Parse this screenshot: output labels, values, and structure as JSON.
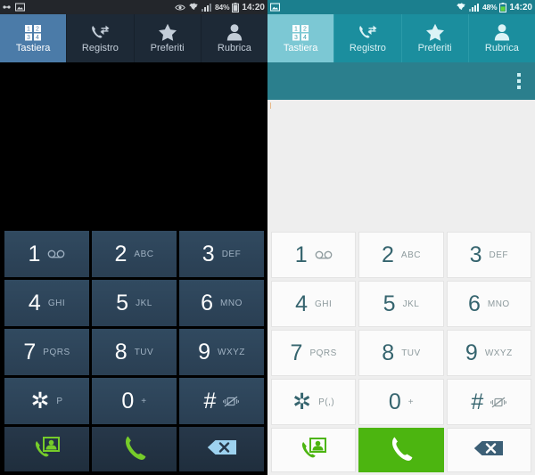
{
  "screens": [
    {
      "id": "dark-dialer",
      "theme": "dark",
      "statusbar": {
        "left_icons": [
          "usb-debug-icon",
          "screenshot-icon"
        ],
        "right_icons": [
          "smart-stay-eye-icon",
          "wifi-icon",
          "signal-icon"
        ],
        "battery_percent": "84%",
        "battery_icon": "battery-icon",
        "time": "14:20"
      },
      "tabs": [
        {
          "label": "Tastiera",
          "icon": "keypad-icon",
          "active": true
        },
        {
          "label": "Registro",
          "icon": "call-log-icon",
          "active": false
        },
        {
          "label": "Preferiti",
          "icon": "star-icon",
          "active": false
        },
        {
          "label": "Rubrica",
          "icon": "contact-icon",
          "active": false
        }
      ],
      "display_value": "",
      "keys": [
        {
          "digit": "1",
          "sub": "",
          "sub_icon": "voicemail-icon"
        },
        {
          "digit": "2",
          "sub": "ABC",
          "sub_icon": ""
        },
        {
          "digit": "3",
          "sub": "DEF",
          "sub_icon": ""
        },
        {
          "digit": "4",
          "sub": "GHI",
          "sub_icon": ""
        },
        {
          "digit": "5",
          "sub": "JKL",
          "sub_icon": ""
        },
        {
          "digit": "6",
          "sub": "MNO",
          "sub_icon": ""
        },
        {
          "digit": "7",
          "sub": "PQRS",
          "sub_icon": ""
        },
        {
          "digit": "8",
          "sub": "TUV",
          "sub_icon": ""
        },
        {
          "digit": "9",
          "sub": "WXYZ",
          "sub_icon": ""
        },
        {
          "digit": "✲",
          "sub": "P",
          "sub_icon": ""
        },
        {
          "digit": "0",
          "sub": "+",
          "sub_icon": ""
        },
        {
          "digit": "#",
          "sub": "",
          "sub_icon": "vibrate-off-icon"
        }
      ],
      "actions": [
        {
          "name": "add-contact-call-button",
          "icon": "add-contact-call-icon",
          "primary": false
        },
        {
          "name": "call-button",
          "icon": "call-icon",
          "primary": false
        },
        {
          "name": "backspace-button",
          "icon": "backspace-icon",
          "primary": false
        }
      ],
      "colors": {
        "status_bg": "#23262b",
        "tab_bg": "#1d2936",
        "tab_active_bg": "#4b7ba8",
        "key_bg": "#2d4358",
        "display_bg": "#000000",
        "accent_green": "#76cc2a",
        "backspace_blue": "#9dd2ef"
      }
    },
    {
      "id": "teal-dialer",
      "theme": "light",
      "statusbar": {
        "left_icons": [
          "screenshot-icon"
        ],
        "right_icons": [
          "wifi-icon",
          "signal-icon"
        ],
        "battery_percent": "48%",
        "battery_icon": "battery-icon",
        "time": "14:20"
      },
      "tabs": [
        {
          "label": "Tastiera",
          "icon": "keypad-icon",
          "active": true
        },
        {
          "label": "Registro",
          "icon": "call-log-icon",
          "active": false
        },
        {
          "label": "Preferiti",
          "icon": "star-icon",
          "active": false
        },
        {
          "label": "Rubrica",
          "icon": "contact-icon",
          "active": false
        }
      ],
      "overflow_menu": "more-options-icon",
      "display_value": "",
      "keys": [
        {
          "digit": "1",
          "sub": "",
          "sub_icon": "voicemail-icon"
        },
        {
          "digit": "2",
          "sub": "ABC",
          "sub_icon": ""
        },
        {
          "digit": "3",
          "sub": "DEF",
          "sub_icon": ""
        },
        {
          "digit": "4",
          "sub": "GHI",
          "sub_icon": ""
        },
        {
          "digit": "5",
          "sub": "JKL",
          "sub_icon": ""
        },
        {
          "digit": "6",
          "sub": "MNO",
          "sub_icon": ""
        },
        {
          "digit": "7",
          "sub": "PQRS",
          "sub_icon": ""
        },
        {
          "digit": "8",
          "sub": "TUV",
          "sub_icon": ""
        },
        {
          "digit": "9",
          "sub": "WXYZ",
          "sub_icon": ""
        },
        {
          "digit": "✲",
          "sub": "P(,)",
          "sub_icon": ""
        },
        {
          "digit": "0",
          "sub": "+",
          "sub_icon": ""
        },
        {
          "digit": "#",
          "sub": "",
          "sub_icon": "vibrate-off-icon"
        }
      ],
      "actions": [
        {
          "name": "add-contact-call-button",
          "icon": "add-contact-call-icon",
          "primary": false
        },
        {
          "name": "call-button",
          "icon": "call-icon",
          "primary": true
        },
        {
          "name": "backspace-button",
          "icon": "backspace-icon",
          "primary": false
        }
      ],
      "colors": {
        "status_bg": "#1b7f8e",
        "tab_bg": "#1b8e9e",
        "tab_active_bg": "#7cc8d4",
        "actionbar_bg": "#2b7f8d",
        "key_bg": "#fbfbfb",
        "display_bg": "#eeeeee",
        "accent_green": "#4cb510",
        "call_button_bg": "#4cb510",
        "key_text": "#35646e"
      }
    }
  ]
}
